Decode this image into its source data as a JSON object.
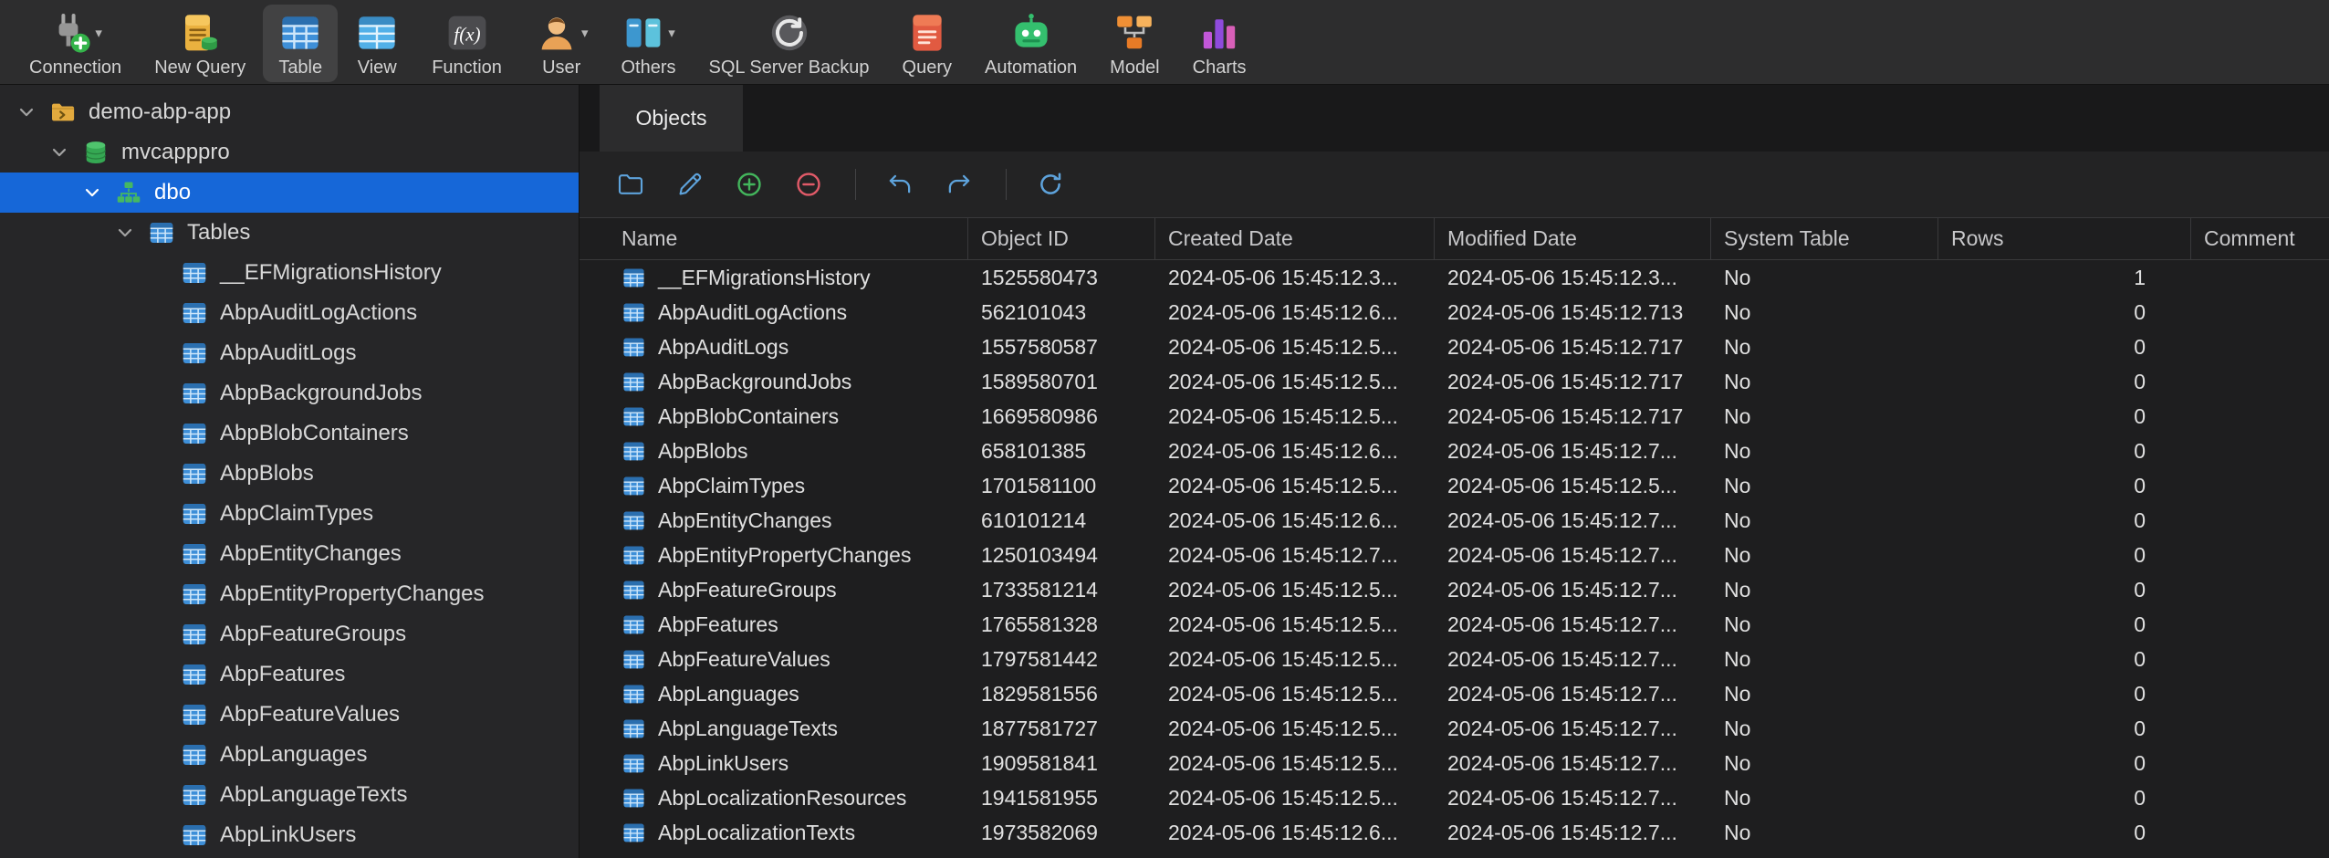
{
  "colors": {
    "sidebar_selection": "#1667d8",
    "table_icon_blue": "#3e8fd8"
  },
  "toolbar": {
    "items": [
      {
        "label": "Connection",
        "icon": "connection-icon",
        "dropdown": true
      },
      {
        "label": "New Query",
        "icon": "new-query-icon"
      },
      {
        "label": "Table",
        "icon": "table-icon",
        "active": true
      },
      {
        "label": "View",
        "icon": "view-icon"
      },
      {
        "label": "Function",
        "icon": "function-icon"
      },
      {
        "label": "User",
        "icon": "user-icon",
        "dropdown": true
      },
      {
        "label": "Others",
        "icon": "others-icon",
        "dropdown": true
      },
      {
        "label": "SQL Server Backup",
        "icon": "sql-server-backup-icon"
      },
      {
        "label": "Query",
        "icon": "query-icon"
      },
      {
        "label": "Automation",
        "icon": "automation-icon"
      },
      {
        "label": "Model",
        "icon": "model-icon"
      },
      {
        "label": "Charts",
        "icon": "charts-icon"
      }
    ]
  },
  "sidebar": {
    "tree": [
      {
        "label": "demo-abp-app",
        "level": 0,
        "icon": "project-icon",
        "expanded": true
      },
      {
        "label": "mvcapppro",
        "level": 1,
        "icon": "database-icon",
        "expanded": true
      },
      {
        "label": "dbo",
        "level": 2,
        "icon": "schema-icon",
        "expanded": true,
        "selected": true
      },
      {
        "label": "Tables",
        "level": 3,
        "icon": "tables-icon",
        "expanded": true
      },
      {
        "label": "__EFMigrationsHistory",
        "level": 4,
        "icon": "table-icon"
      },
      {
        "label": "AbpAuditLogActions",
        "level": 4,
        "icon": "table-icon"
      },
      {
        "label": "AbpAuditLogs",
        "level": 4,
        "icon": "table-icon"
      },
      {
        "label": "AbpBackgroundJobs",
        "level": 4,
        "icon": "table-icon"
      },
      {
        "label": "AbpBlobContainers",
        "level": 4,
        "icon": "table-icon"
      },
      {
        "label": "AbpBlobs",
        "level": 4,
        "icon": "table-icon"
      },
      {
        "label": "AbpClaimTypes",
        "level": 4,
        "icon": "table-icon"
      },
      {
        "label": "AbpEntityChanges",
        "level": 4,
        "icon": "table-icon"
      },
      {
        "label": "AbpEntityPropertyChanges",
        "level": 4,
        "icon": "table-icon"
      },
      {
        "label": "AbpFeatureGroups",
        "level": 4,
        "icon": "table-icon"
      },
      {
        "label": "AbpFeatures",
        "level": 4,
        "icon": "table-icon"
      },
      {
        "label": "AbpFeatureValues",
        "level": 4,
        "icon": "table-icon"
      },
      {
        "label": "AbpLanguages",
        "level": 4,
        "icon": "table-icon"
      },
      {
        "label": "AbpLanguageTexts",
        "level": 4,
        "icon": "table-icon"
      },
      {
        "label": "AbpLinkUsers",
        "level": 4,
        "icon": "table-icon"
      }
    ]
  },
  "objects_toolbar": {
    "buttons": [
      {
        "name": "open-table-button",
        "icon": "folder-icon"
      },
      {
        "name": "design-table-button",
        "icon": "pencil-icon"
      },
      {
        "name": "new-table-button",
        "icon": "plus-circle-icon"
      },
      {
        "name": "delete-table-button",
        "icon": "minus-circle-icon"
      },
      {
        "sep": true
      },
      {
        "name": "import-wizard-button",
        "icon": "curved-arrow-left-icon"
      },
      {
        "name": "export-wizard-button",
        "icon": "curved-arrow-right-icon"
      },
      {
        "sep": true
      },
      {
        "name": "refresh-button",
        "icon": "refresh-icon"
      }
    ]
  },
  "main": {
    "tab_label": "Objects",
    "table": {
      "columns": [
        "Name",
        "Object ID",
        "Created Date",
        "Modified Date",
        "System Table",
        "Rows",
        "Comment"
      ],
      "rows": [
        {
          "name": "__EFMigrationsHistory",
          "object_id": "1525580473",
          "created_date": "2024-05-06 15:45:12.3...",
          "modified_date": "2024-05-06 15:45:12.3...",
          "system_table": "No",
          "rows": "1",
          "comment": ""
        },
        {
          "name": "AbpAuditLogActions",
          "object_id": "562101043",
          "created_date": "2024-05-06 15:45:12.6...",
          "modified_date": "2024-05-06 15:45:12.713",
          "system_table": "No",
          "rows": "0",
          "comment": ""
        },
        {
          "name": "AbpAuditLogs",
          "object_id": "1557580587",
          "created_date": "2024-05-06 15:45:12.5...",
          "modified_date": "2024-05-06 15:45:12.717",
          "system_table": "No",
          "rows": "0",
          "comment": ""
        },
        {
          "name": "AbpBackgroundJobs",
          "object_id": "1589580701",
          "created_date": "2024-05-06 15:45:12.5...",
          "modified_date": "2024-05-06 15:45:12.717",
          "system_table": "No",
          "rows": "0",
          "comment": ""
        },
        {
          "name": "AbpBlobContainers",
          "object_id": "1669580986",
          "created_date": "2024-05-06 15:45:12.5...",
          "modified_date": "2024-05-06 15:45:12.717",
          "system_table": "No",
          "rows": "0",
          "comment": ""
        },
        {
          "name": "AbpBlobs",
          "object_id": "658101385",
          "created_date": "2024-05-06 15:45:12.6...",
          "modified_date": "2024-05-06 15:45:12.7...",
          "system_table": "No",
          "rows": "0",
          "comment": ""
        },
        {
          "name": "AbpClaimTypes",
          "object_id": "1701581100",
          "created_date": "2024-05-06 15:45:12.5...",
          "modified_date": "2024-05-06 15:45:12.5...",
          "system_table": "No",
          "rows": "0",
          "comment": ""
        },
        {
          "name": "AbpEntityChanges",
          "object_id": "610101214",
          "created_date": "2024-05-06 15:45:12.6...",
          "modified_date": "2024-05-06 15:45:12.7...",
          "system_table": "No",
          "rows": "0",
          "comment": ""
        },
        {
          "name": "AbpEntityPropertyChanges",
          "object_id": "1250103494",
          "created_date": "2024-05-06 15:45:12.7...",
          "modified_date": "2024-05-06 15:45:12.7...",
          "system_table": "No",
          "rows": "0",
          "comment": ""
        },
        {
          "name": "AbpFeatureGroups",
          "object_id": "1733581214",
          "created_date": "2024-05-06 15:45:12.5...",
          "modified_date": "2024-05-06 15:45:12.7...",
          "system_table": "No",
          "rows": "0",
          "comment": ""
        },
        {
          "name": "AbpFeatures",
          "object_id": "1765581328",
          "created_date": "2024-05-06 15:45:12.5...",
          "modified_date": "2024-05-06 15:45:12.7...",
          "system_table": "No",
          "rows": "0",
          "comment": ""
        },
        {
          "name": "AbpFeatureValues",
          "object_id": "1797581442",
          "created_date": "2024-05-06 15:45:12.5...",
          "modified_date": "2024-05-06 15:45:12.7...",
          "system_table": "No",
          "rows": "0",
          "comment": ""
        },
        {
          "name": "AbpLanguages",
          "object_id": "1829581556",
          "created_date": "2024-05-06 15:45:12.5...",
          "modified_date": "2024-05-06 15:45:12.7...",
          "system_table": "No",
          "rows": "0",
          "comment": ""
        },
        {
          "name": "AbpLanguageTexts",
          "object_id": "1877581727",
          "created_date": "2024-05-06 15:45:12.5...",
          "modified_date": "2024-05-06 15:45:12.7...",
          "system_table": "No",
          "rows": "0",
          "comment": ""
        },
        {
          "name": "AbpLinkUsers",
          "object_id": "1909581841",
          "created_date": "2024-05-06 15:45:12.5...",
          "modified_date": "2024-05-06 15:45:12.7...",
          "system_table": "No",
          "rows": "0",
          "comment": ""
        },
        {
          "name": "AbpLocalizationResources",
          "object_id": "1941581955",
          "created_date": "2024-05-06 15:45:12.5...",
          "modified_date": "2024-05-06 15:45:12.7...",
          "system_table": "No",
          "rows": "0",
          "comment": ""
        },
        {
          "name": "AbpLocalizationTexts",
          "object_id": "1973582069",
          "created_date": "2024-05-06 15:45:12.6...",
          "modified_date": "2024-05-06 15:45:12.7...",
          "system_table": "No",
          "rows": "0",
          "comment": ""
        }
      ]
    }
  }
}
